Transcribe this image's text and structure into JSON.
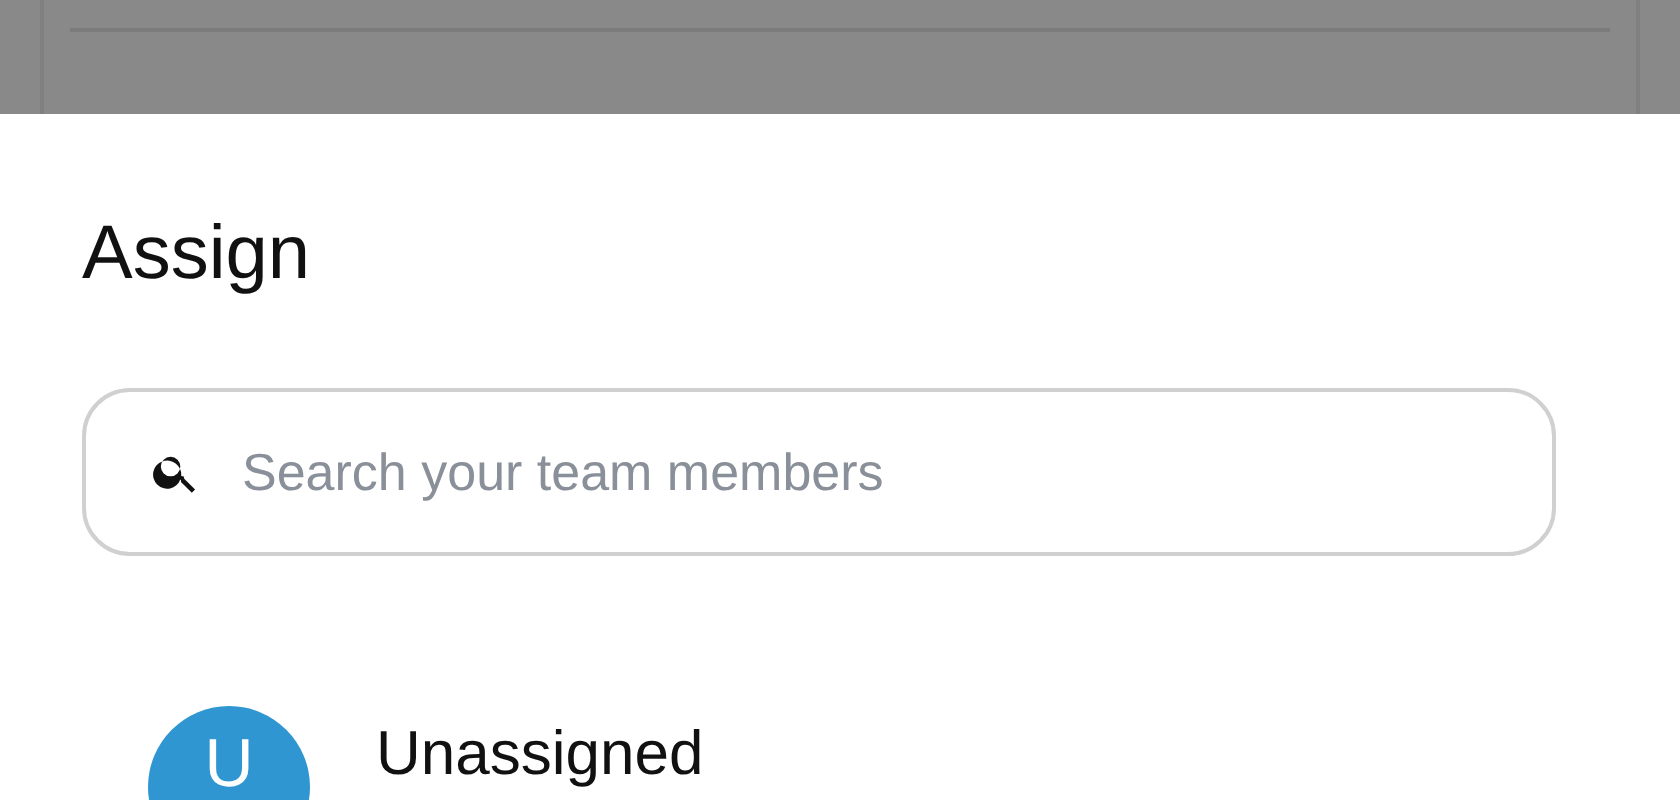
{
  "sheet": {
    "title": "Assign",
    "search": {
      "placeholder": "Search your team members"
    },
    "members": [
      {
        "initial": "U",
        "name": "Unassigned"
      }
    ]
  }
}
